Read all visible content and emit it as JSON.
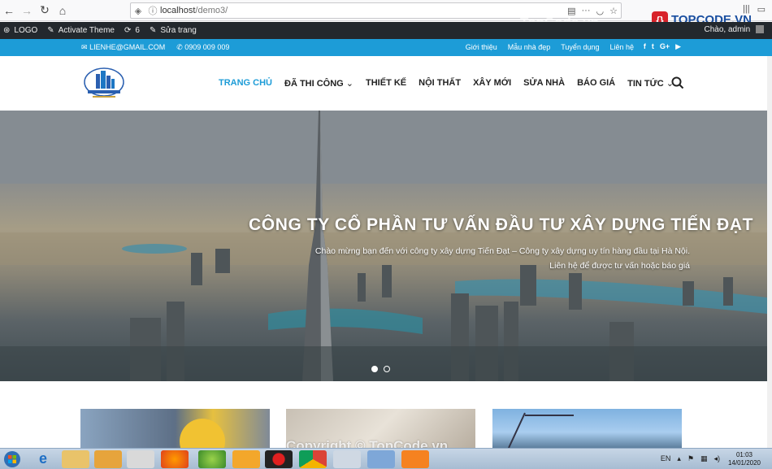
{
  "browser": {
    "url_host": "localhost",
    "url_path": "/demo3/"
  },
  "wp_bar": {
    "logo_label": "LOGO",
    "activate_theme": "Activate Theme",
    "updates_count": "6",
    "edit_page": "Sửa trang",
    "greeting": "Chào, admin"
  },
  "topbar": {
    "email": "LIENHE@GMAIL.COM",
    "phone": "0909 009 009",
    "links": [
      "Giới thiệu",
      "Mẫu nhà đẹp",
      "Tuyển dụng",
      "Liên hệ"
    ]
  },
  "header": {
    "menu": [
      "TRANG CHỦ",
      "ĐÃ THI CÔNG",
      "THIẾT KẾ",
      "NỘI THẤT",
      "XÂY MỚI",
      "SỬA NHÀ",
      "BÁO GIÁ",
      "TIN TỨC"
    ]
  },
  "hero": {
    "title": "CÔNG TY CỔ PHẦN TƯ VẤN ĐẦU TƯ XÂY DỰNG TIẾN ĐẠT",
    "subtitle_line1": "Chào mừng bạn đến với công ty xây dựng Tiến Đạt – Công ty xây dựng uy tín hàng đầu tại Hà Nội.",
    "subtitle_line2": "Liên hệ để được tư vấn hoặc báo giá"
  },
  "watermark": {
    "top": "TopCode.vn",
    "bottom": "Copyright © TopCode.vn",
    "brand": "TOPCODE.VN"
  },
  "taskbar": {
    "lang": "EN",
    "time": "01:03",
    "date": "14/01/2020"
  },
  "colors": {
    "accent": "#1d9cd7",
    "wp_bar": "#23282d"
  }
}
